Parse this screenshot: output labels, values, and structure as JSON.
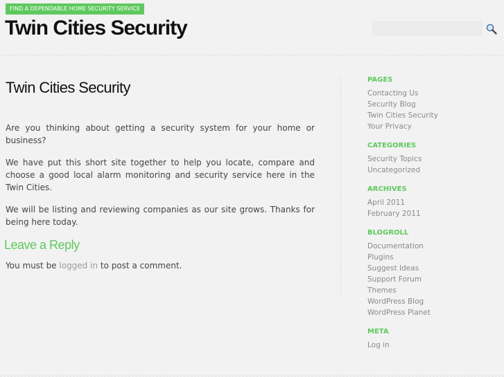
{
  "header": {
    "tagline": "FIND A DEPENDABLE HOME SECURITY SERVICE",
    "site_title": "Twin Cities Security",
    "search_placeholder": ""
  },
  "post": {
    "title": "Twin Cities Security",
    "paragraphs": [
      "Are you thinking about getting a security system for your home or business?",
      "We have put this short site together to help you locate, compare and choose a good local alarm monitoring and security service here in the Twin Cities.",
      "We will be listing and reviewing companies as our site grows. Thanks for being here today."
    ]
  },
  "comments": {
    "heading": "Leave a Reply",
    "note_before": "You must be ",
    "note_link": "logged in",
    "note_after": " to post a comment."
  },
  "sidebar": {
    "pages": {
      "heading": "PAGES",
      "items": [
        "Contacting Us",
        "Security Blog",
        "Twin Cities Security",
        "Your Privacy"
      ]
    },
    "categories": {
      "heading": "CATEGORIES",
      "items": [
        "Security Topics",
        "Uncategorized"
      ]
    },
    "archives": {
      "heading": "ARCHIVES",
      "items": [
        "April 2011",
        "February 2011"
      ]
    },
    "blogroll": {
      "heading": "BLOGROLL",
      "items": [
        "Documentation",
        "Plugins",
        "Suggest Ideas",
        "Support Forum",
        "Themes",
        "WordPress Blog",
        "WordPress Planet"
      ]
    },
    "meta": {
      "heading": "META",
      "items": [
        "Log in"
      ]
    }
  },
  "icons": {
    "search": "search-icon"
  },
  "colors": {
    "accent": "#5fc95f",
    "title": "#111111",
    "text": "#444444",
    "link_muted": "#8a8a8a",
    "background": "#f2f2f2"
  }
}
